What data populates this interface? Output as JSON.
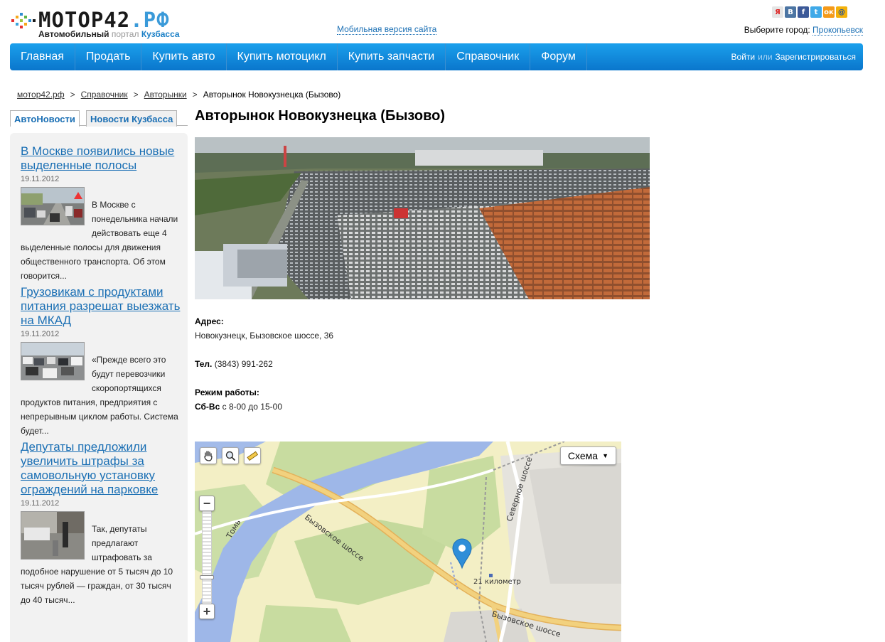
{
  "header": {
    "logo_text": "МОТОР42",
    "logo_tld": ".РФ",
    "logo_sub_bold": "Автомобильный",
    "logo_sub_gray": "портал",
    "logo_sub_blue": "Кузбасса",
    "mobile_link": "Мобильная версия сайта",
    "city_label": "Выберите город:",
    "city_value": "Прокопьевск",
    "social": [
      {
        "icon": "ya-icon",
        "glyph": "Я",
        "color": "#e5e5e5",
        "fg": "#d22"
      },
      {
        "icon": "vk-icon",
        "glyph": "В",
        "color": "#4c75a3",
        "fg": "#fff"
      },
      {
        "icon": "facebook-icon",
        "glyph": "f",
        "color": "#3b5998",
        "fg": "#fff"
      },
      {
        "icon": "twitter-icon",
        "glyph": "t",
        "color": "#3fa9e8",
        "fg": "#fff"
      },
      {
        "icon": "odnoklassniki-icon",
        "glyph": "ок",
        "color": "#f59a19",
        "fg": "#fff"
      },
      {
        "icon": "mail-icon",
        "glyph": "@",
        "color": "#f3b10a",
        "fg": "#1a4fa0"
      }
    ]
  },
  "nav": {
    "items": [
      "Главная",
      "Продать",
      "Купить авто",
      "Купить мотоцикл",
      "Купить запчасти",
      "Справочник",
      "Форум"
    ],
    "login": "Войти",
    "or": "или",
    "register": "Зарегистрироваться"
  },
  "breadcrumb": {
    "items": [
      "мотор42.рф",
      "Справочник",
      "Авторынки"
    ],
    "current": "Авторынок Новокузнецка (Бызово)",
    "separator": ">"
  },
  "sidebar": {
    "tabs": [
      "АвтоНовости",
      "Новости Кузбасса"
    ],
    "news": [
      {
        "title": "В Москве появились новые выделенные полосы",
        "date": "19.11.2012",
        "text": "В Москве с понедельника начали действовать еще 4 выделенные полосы для движения общественного транспорта. Об этом говорится..."
      },
      {
        "title": "Грузовикам с продуктами питания разрешат выезжать на МКАД",
        "date": "19.11.2012",
        "text": "«Прежде всего это будут перевозчики скоропортящихся продуктов питания, предприятия с непрерывным циклом работы. Система будет..."
      },
      {
        "title": "Депутаты предложили увеличить штрафы за самовольную установку ограждений на парковке",
        "date": "19.11.2012",
        "text": "Так, депутаты предлагают штрафовать за подобное нарушение от 5 тысяч до 10 тысяч рублей — граждан, от 30 тысяч до 40 тысяч..."
      }
    ]
  },
  "main": {
    "title": "Авторынок Новокузнецка (Бызово)",
    "address_label": "Адрес:",
    "address": "Новокузнецк, Бызовское шоссе, 36",
    "phone_label": "Тел.",
    "phone": "(3843) 991-262",
    "hours_label": "Режим работы:",
    "hours_days": "Сб-Вс",
    "hours_value": "с  8-00 до 15-00"
  },
  "map": {
    "scheme_label": "Схема",
    "labels": {
      "road1": "Бызовское шоссе",
      "road2": "Бызовское шоссе",
      "road3": "Северное шоссе",
      "river": "Томь",
      "stop": "21 километр"
    },
    "zoom_in": "+",
    "zoom_out": "−"
  }
}
